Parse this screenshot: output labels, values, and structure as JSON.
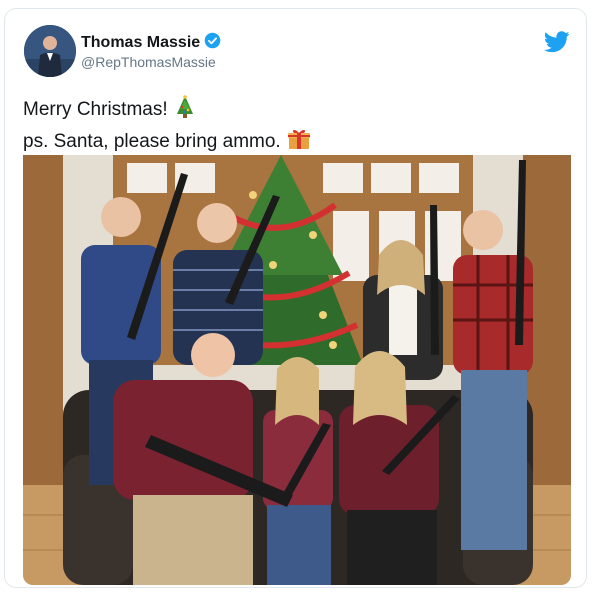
{
  "tweet": {
    "author": {
      "display_name": "Thomas Massie",
      "handle": "@RepThomasMassie",
      "verified": true,
      "avatar_icon": "profile-photo"
    },
    "brand_icon": "twitter-bird-icon",
    "text_lines": [
      "Merry Christmas!",
      "ps. Santa, please bring ammo."
    ],
    "emojis": [
      "christmas-tree-icon",
      "wrapped-gift-icon"
    ],
    "media": {
      "type": "photo",
      "description_icon": "family-christmas-photo"
    }
  },
  "colors": {
    "twitter_blue": "#1da1f2",
    "text": "#14171a",
    "secondary_text": "#657786"
  }
}
